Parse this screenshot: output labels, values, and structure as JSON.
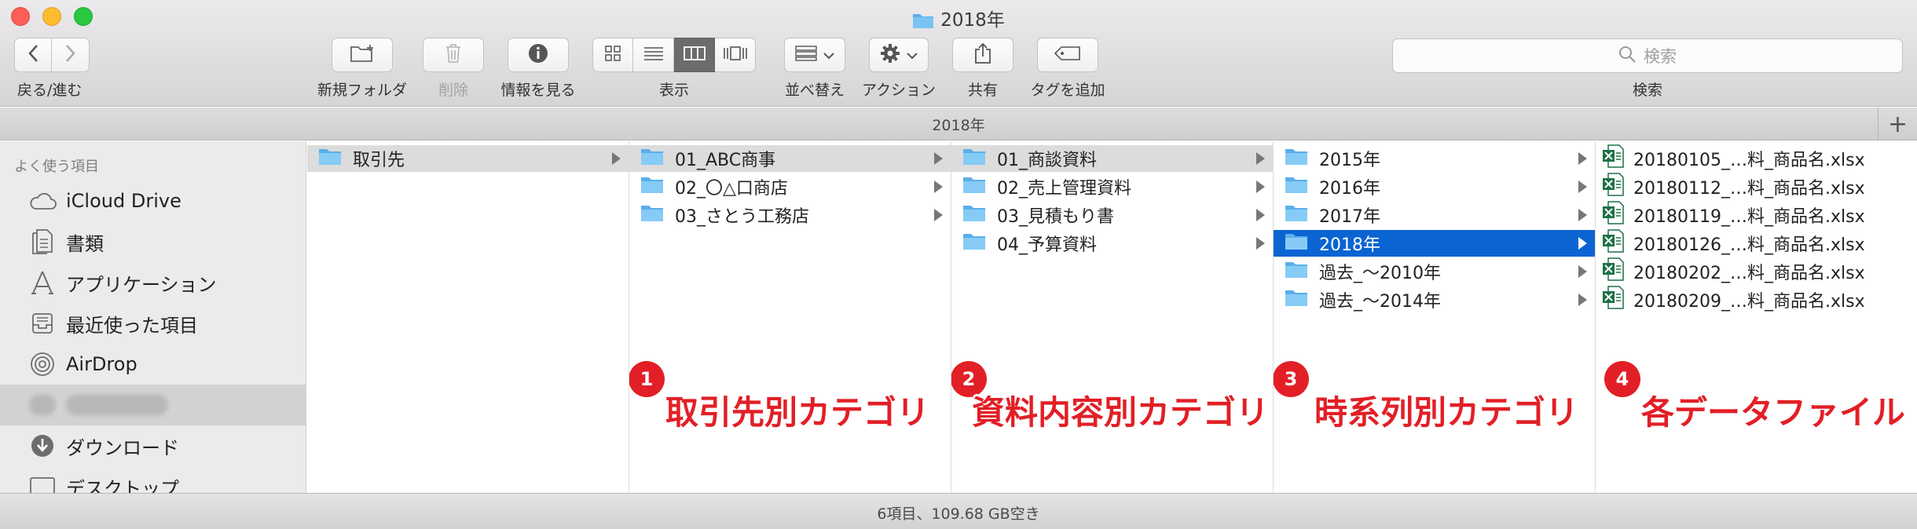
{
  "window": {
    "title": "2018年"
  },
  "toolbar": {
    "back_forward_label": "戻る/進む",
    "new_folder_label": "新規フォルダ",
    "delete_label": "削除",
    "info_label": "情報を見る",
    "view_label": "表示",
    "sort_label": "並べ替え",
    "action_label": "アクション",
    "share_label": "共有",
    "tag_label": "タグを追加",
    "search_label": "検索",
    "search_placeholder": "検索"
  },
  "pathbar": {
    "title": "2018年",
    "add_tab": "+"
  },
  "sidebar": {
    "section": "よく使う項目",
    "items": [
      {
        "label": "iCloud Drive",
        "icon": "cloud-icon"
      },
      {
        "label": "書類",
        "icon": "document-icon"
      },
      {
        "label": "アプリケーション",
        "icon": "applications-icon"
      },
      {
        "label": "最近使った項目",
        "icon": "recents-icon"
      },
      {
        "label": "AirDrop",
        "icon": "airdrop-icon"
      },
      {
        "label": "",
        "icon": "home-icon"
      },
      {
        "label": "ダウンロード",
        "icon": "download-icon"
      },
      {
        "label": "デスクトップ",
        "icon": "desktop-icon"
      }
    ]
  },
  "columns": [
    {
      "items": [
        {
          "label": "取引先",
          "state": "path"
        }
      ]
    },
    {
      "items": [
        {
          "label": "01_ABC商事",
          "state": "path"
        },
        {
          "label": "02_〇△口商店",
          "state": ""
        },
        {
          "label": "03_さとう工務店",
          "state": ""
        }
      ]
    },
    {
      "items": [
        {
          "label": "01_商談資料",
          "state": "path"
        },
        {
          "label": "02_売上管理資料",
          "state": ""
        },
        {
          "label": "03_見積もり書",
          "state": ""
        },
        {
          "label": "04_予算資料",
          "state": ""
        }
      ]
    },
    {
      "items": [
        {
          "label": "2015年",
          "state": ""
        },
        {
          "label": "2016年",
          "state": ""
        },
        {
          "label": "2017年",
          "state": ""
        },
        {
          "label": "2018年",
          "state": "selected"
        },
        {
          "label": "過去_〜2010年",
          "state": ""
        },
        {
          "label": "過去_〜2014年",
          "state": ""
        }
      ]
    },
    {
      "items": [
        {
          "label": "20180105_…料_商品名.xlsx"
        },
        {
          "label": "20180112_…料_商品名.xlsx"
        },
        {
          "label": "20180119_…料_商品名.xlsx"
        },
        {
          "label": "20180126_…料_商品名.xlsx"
        },
        {
          "label": "20180202_…料_商品名.xlsx"
        },
        {
          "label": "20180209_…料_商品名.xlsx"
        }
      ]
    }
  ],
  "annotations": [
    {
      "number": "1",
      "text": "取引先別カテゴリ"
    },
    {
      "number": "2",
      "text": "資料内容別カテゴリ"
    },
    {
      "number": "3",
      "text": "時系列別カテゴリ"
    },
    {
      "number": "4",
      "text": "各データファイル"
    }
  ],
  "colors": {
    "selection": "#0a64d2",
    "annotation": "#e21f26",
    "folder": "#5aaeea",
    "excel": "#1d7145"
  },
  "status": {
    "text": "6項目、109.68 GB空き"
  }
}
